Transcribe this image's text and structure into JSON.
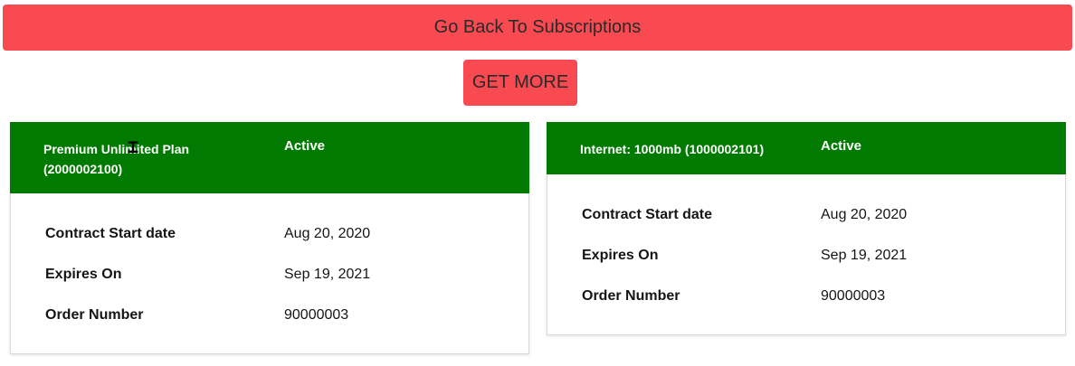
{
  "actions": {
    "back_label": "Go Back To Subscriptions",
    "get_more_label": "GET MORE"
  },
  "subscriptions": [
    {
      "plan_name": "Premium Unlimited Plan (2000002100)",
      "status": "Active",
      "details": [
        {
          "label": "Contract Start date",
          "value": "Aug 20, 2020"
        },
        {
          "label": "Expires On",
          "value": "Sep 19, 2021"
        },
        {
          "label": "Order Number",
          "value": "90000003"
        }
      ]
    },
    {
      "plan_name": "Internet: 1000mb (1000002101)",
      "status": "Active",
      "details": [
        {
          "label": "Contract Start date",
          "value": "Aug 20, 2020"
        },
        {
          "label": "Expires On",
          "value": "Sep 19, 2021"
        },
        {
          "label": "Order Number",
          "value": "90000003"
        }
      ]
    }
  ],
  "colors": {
    "button_red": "#f84a50",
    "header_green": "#007a00"
  }
}
